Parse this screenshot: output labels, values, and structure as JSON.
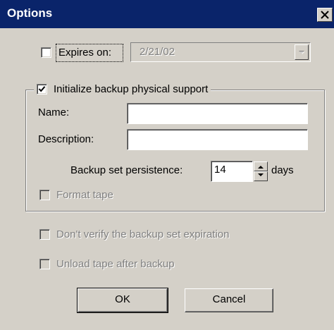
{
  "window": {
    "title": "Options"
  },
  "expires": {
    "label": "Expires on:",
    "checked": false,
    "date_value": "2/21/02"
  },
  "group": {
    "label": "Initialize backup physical support",
    "checked": true,
    "name_label": "Name:",
    "name_value": "",
    "description_label": "Description:",
    "description_value": "",
    "persistence_label": "Backup set persistence:",
    "persistence_value": "14",
    "persistence_unit": "days",
    "format_tape_label": "Format tape"
  },
  "options": {
    "dont_verify_label": "Don't verify the backup set expiration",
    "unload_tape_label": "Unload tape after backup"
  },
  "buttons": {
    "ok": "OK",
    "cancel": "Cancel"
  },
  "icons": {
    "close": "close-icon",
    "dropdown": "chevron-down-icon",
    "check": "checkmark-icon",
    "spin_up": "arrow-up-icon",
    "spin_down": "arrow-down-icon"
  },
  "colors": {
    "titlebar": "#0a246a",
    "dialog_face": "#d4d0c8",
    "disabled_text": "#808080"
  }
}
